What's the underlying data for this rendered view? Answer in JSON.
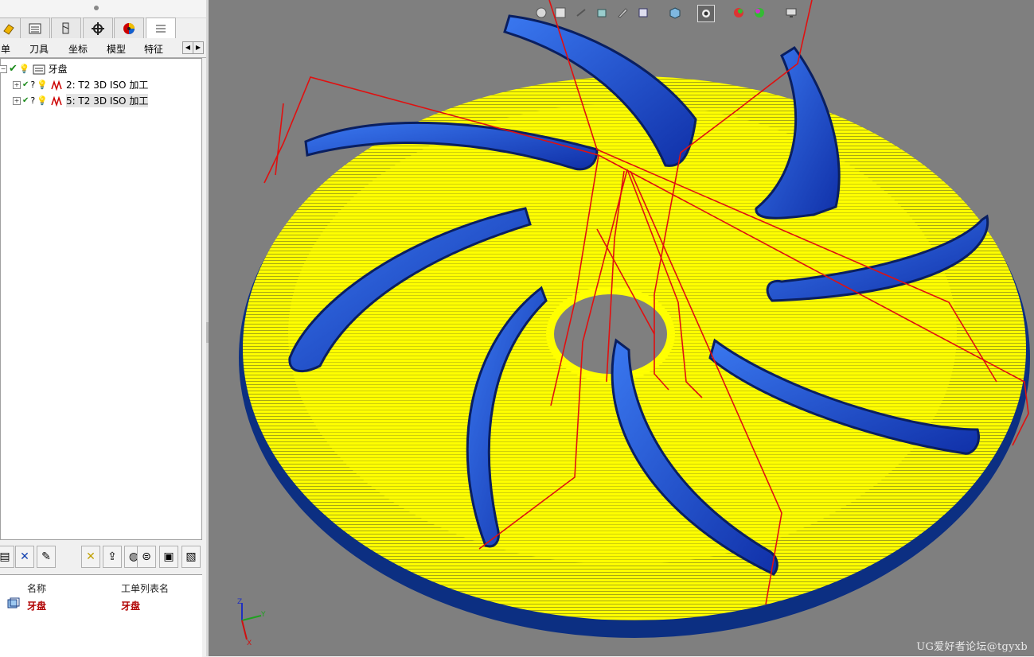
{
  "left_panel": {
    "tabs": [
      {
        "label": "单"
      },
      {
        "label": "刀具"
      },
      {
        "label": "坐标"
      },
      {
        "label": "模型"
      },
      {
        "label": "特征"
      }
    ],
    "tree": {
      "root": {
        "label": "牙盘"
      },
      "operations": [
        {
          "label": "2: T2 3D ISO 加工"
        },
        {
          "label": "5: T2 3D ISO 加工"
        }
      ]
    },
    "list": {
      "columns": [
        "名称",
        "工单列表名"
      ],
      "rows": [
        {
          "name": "牙盘",
          "worklist": "牙盘"
        }
      ]
    }
  },
  "viewport": {
    "triad": {
      "x": "X",
      "y": "Y",
      "z": "Z"
    },
    "watermark": "UG爱好者论坛@tgyxb"
  },
  "colors": {
    "viewport_bg": "#7f7f7f",
    "toolpath": "#ffff00",
    "part": "#1c46c8",
    "link_moves": "#e01010",
    "tree_check": "#1a8a1a",
    "list_value": "#b00000"
  },
  "icons": [
    "machining-icon",
    "operations-list-icon",
    "tool-icon",
    "coordinate-icon",
    "color-icon",
    "menu-lines-icon",
    "check-icon",
    "bulb-icon",
    "expand-icon"
  ]
}
